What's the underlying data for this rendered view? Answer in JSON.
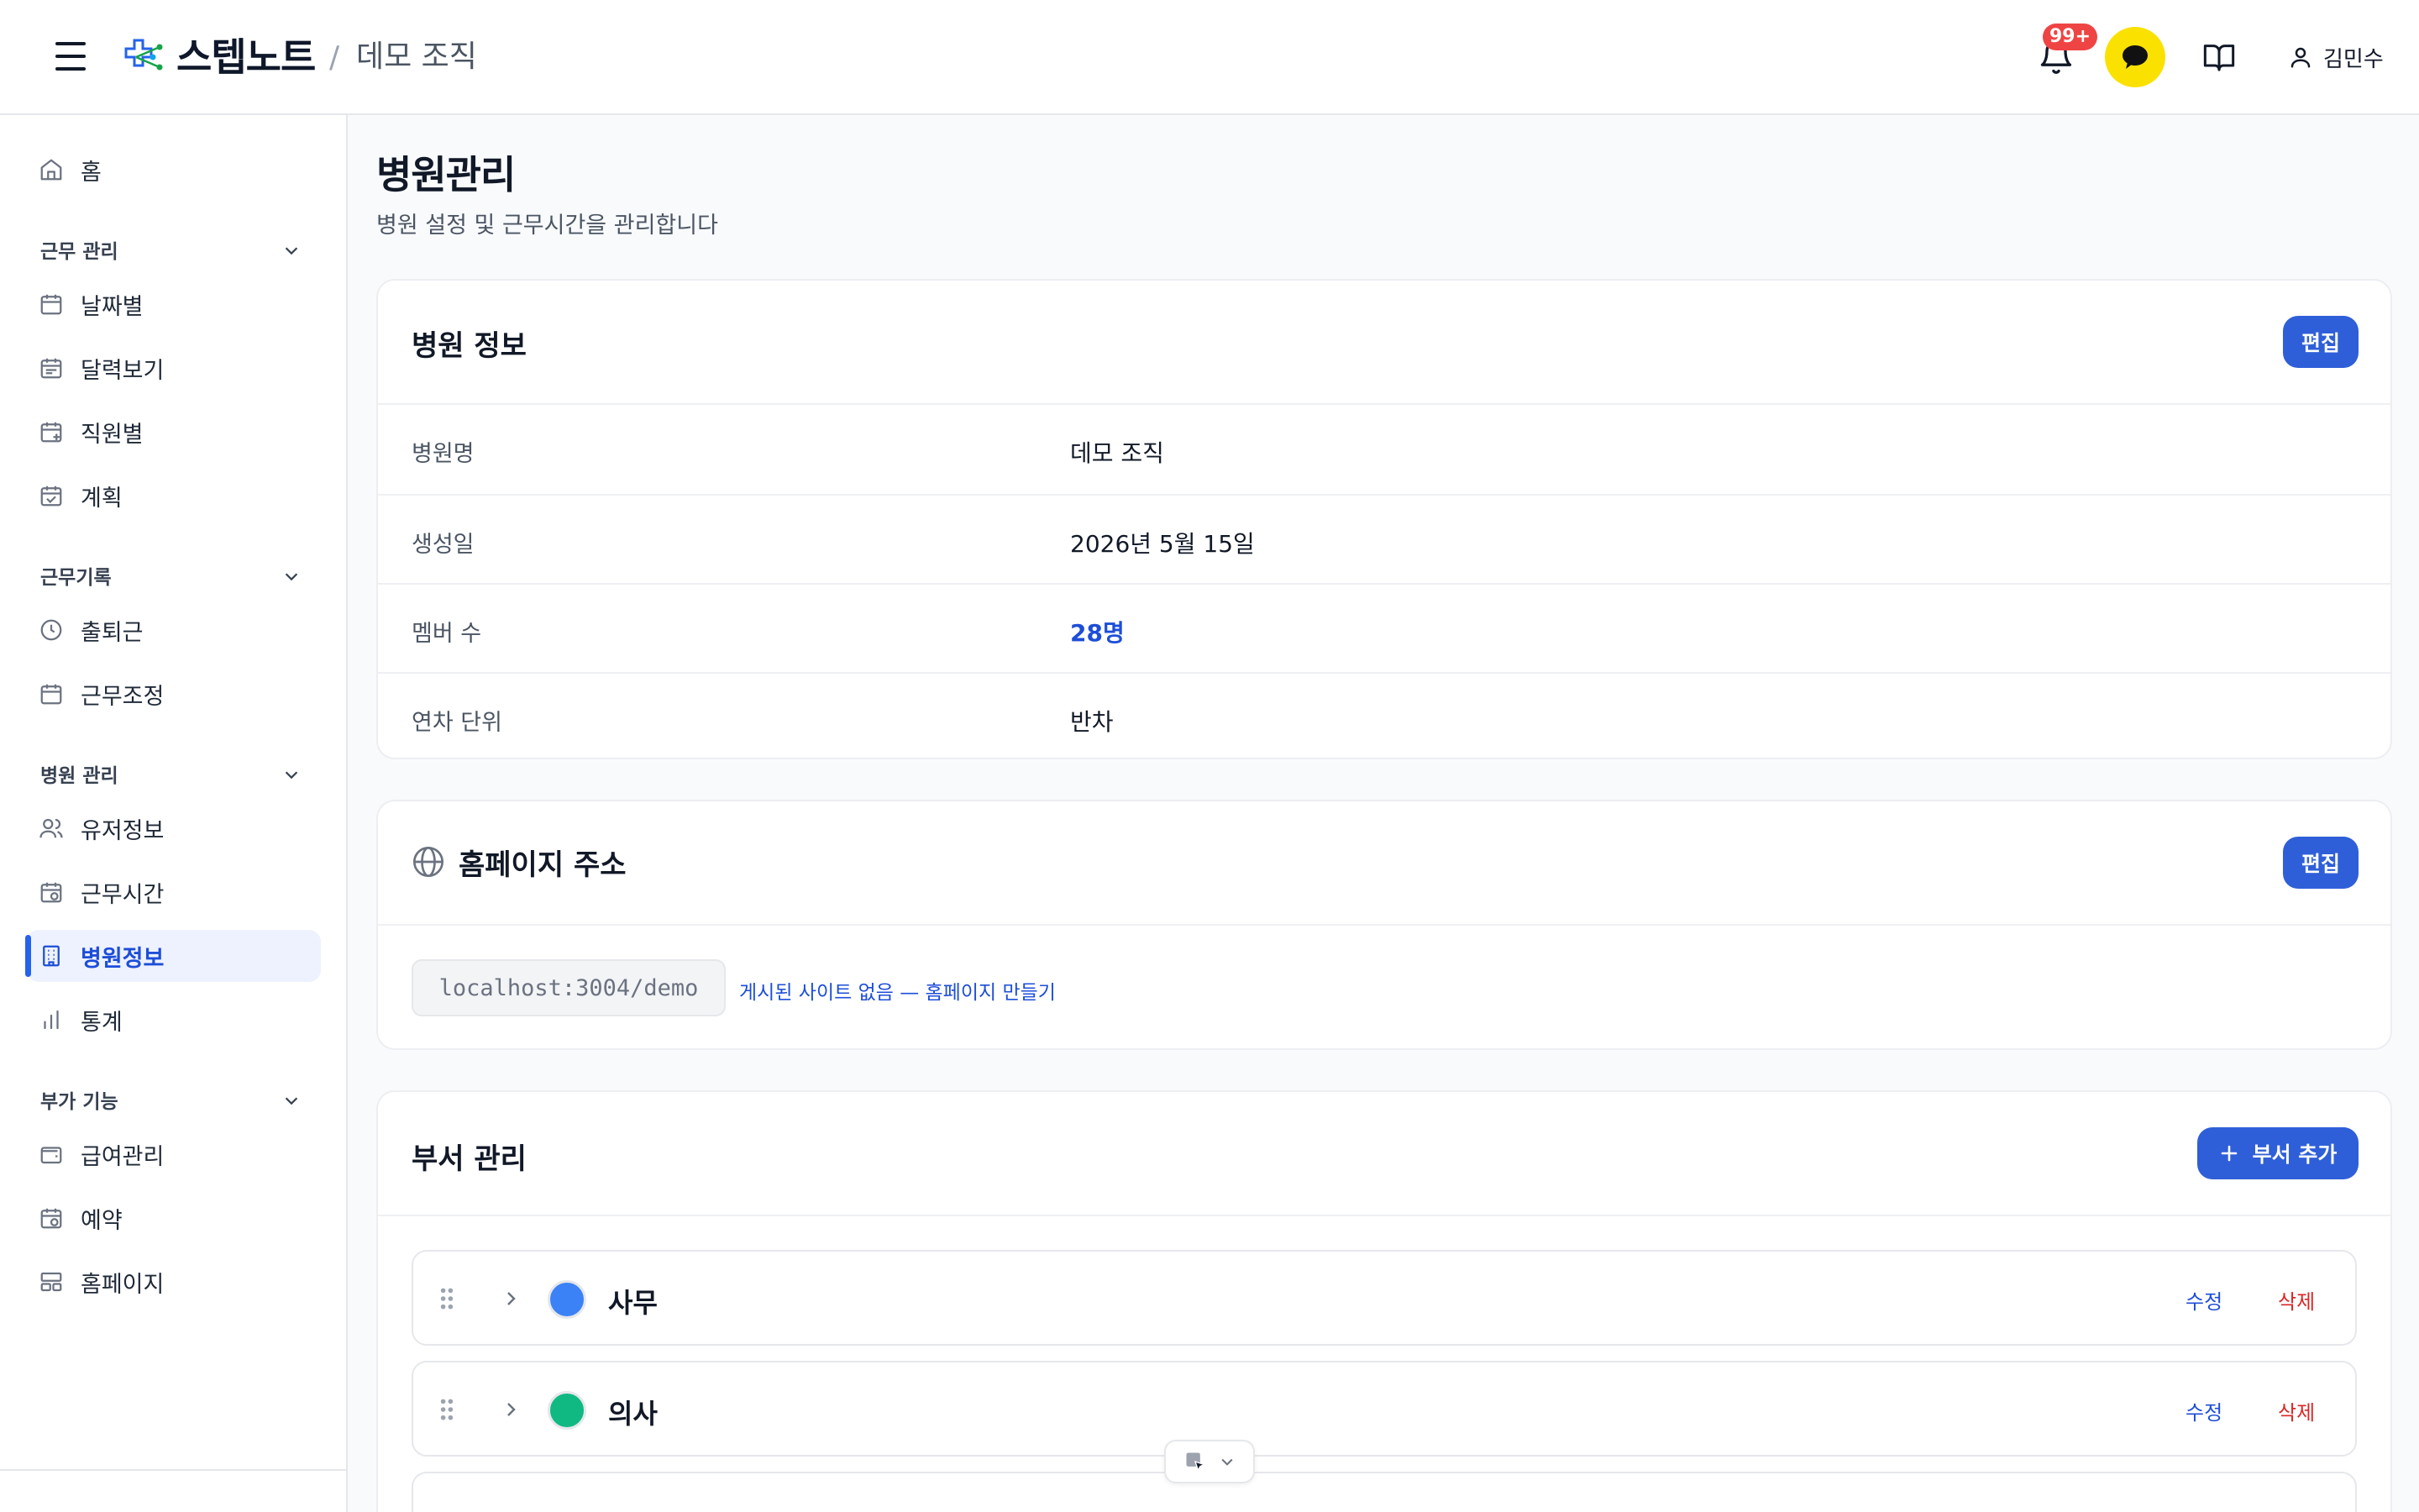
{
  "header": {
    "brand": "스텝노트",
    "separator": "/",
    "org_name": "데모 조직",
    "notification_badge": "99+",
    "user_name": "김민수"
  },
  "sidebar": {
    "home": "홈",
    "sections": [
      {
        "label": "근무 관리",
        "items": [
          "날짜별",
          "달력보기",
          "직원별",
          "계획"
        ]
      },
      {
        "label": "근무기록",
        "items": [
          "출퇴근",
          "근무조정"
        ]
      },
      {
        "label": "병원 관리",
        "items": [
          "유저정보",
          "근무시간",
          "병원정보",
          "통계"
        ]
      },
      {
        "label": "부가 기능",
        "items": [
          "급여관리",
          "예약",
          "홈페이지"
        ]
      }
    ],
    "active_item": "병원정보"
  },
  "page": {
    "title": "병원관리",
    "subtitle": "병원 설정 및 근무시간을 관리합니다"
  },
  "hospital_info": {
    "title": "병원 정보",
    "edit_label": "편집",
    "rows": [
      {
        "key": "병원명",
        "value": "데모 조직"
      },
      {
        "key": "생성일",
        "value": "2026년 5월 15일"
      },
      {
        "key": "멤버 수",
        "value": "28명"
      },
      {
        "key": "연차 단위",
        "value": "반차"
      }
    ]
  },
  "homepage": {
    "title": "홈페이지 주소",
    "edit_label": "편집",
    "url": "localhost:3004/demo",
    "status_link": "게시된 사이트 없음 — 홈페이지 만들기"
  },
  "departments": {
    "title": "부서 관리",
    "add_label": "부서 추가",
    "edit_label": "수정",
    "delete_label": "삭제",
    "items": [
      {
        "name": "사무",
        "color": "#3b82f6"
      },
      {
        "name": "의사",
        "color": "#10b981"
      }
    ]
  },
  "colors": {
    "accent": "#2f5fd8",
    "kakao": "#fae100",
    "danger": "#dc2626",
    "badge": "#ef4444"
  },
  "icons": [
    "menu-icon",
    "logo-icon",
    "bell-icon",
    "chat-icon",
    "book-icon",
    "user-icon",
    "home-icon",
    "calendar-icon",
    "clock-icon",
    "users-icon",
    "building-icon",
    "bar-chart-icon",
    "wallet-icon",
    "layout-icon",
    "globe-icon",
    "plus-icon",
    "drag-handle-icon",
    "chevron-right-icon",
    "chevron-down-icon"
  ]
}
